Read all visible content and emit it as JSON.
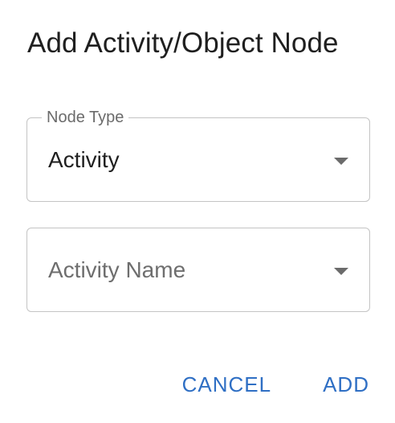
{
  "dialog": {
    "title": "Add Activity/Object Node"
  },
  "node_type_field": {
    "label": "Node Type",
    "value": "Activity",
    "icon": "dropdown-arrow-icon"
  },
  "activity_name_field": {
    "placeholder": "Activity Name",
    "value": "",
    "icon": "dropdown-arrow-icon"
  },
  "actions": {
    "cancel_label": "CANCEL",
    "add_label": "ADD"
  },
  "colors": {
    "accent": "#2f6fc4",
    "border": "#c4c4c4",
    "text": "#1f1f1f",
    "muted": "#6b6b6b"
  }
}
